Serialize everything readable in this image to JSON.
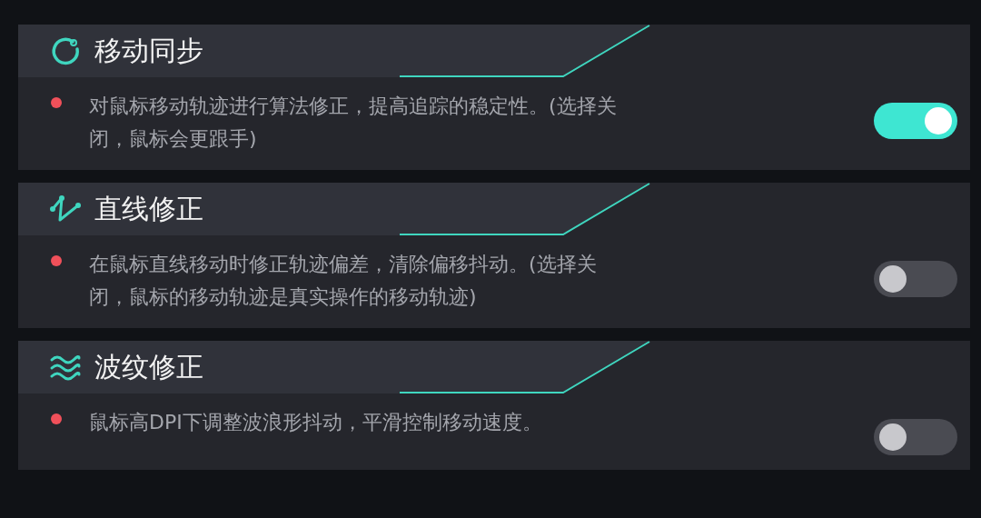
{
  "settings": [
    {
      "kind": "sync",
      "title": "移动同步",
      "description": "对鼠标移动轨迹进行算法修正，提高追踪的稳定性。(选择关闭，鼠标会更跟手)",
      "on": true
    },
    {
      "kind": "line",
      "title": "直线修正",
      "description": "在鼠标直线移动时修正轨迹偏差，清除偏移抖动。(选择关闭，鼠标的移动轨迹是真实操作的移动轨迹)",
      "on": false
    },
    {
      "kind": "wave",
      "title": "波纹修正",
      "description": "鼠标高DPI下调整波浪形抖动，平滑控制移动速度。",
      "on": false
    }
  ]
}
